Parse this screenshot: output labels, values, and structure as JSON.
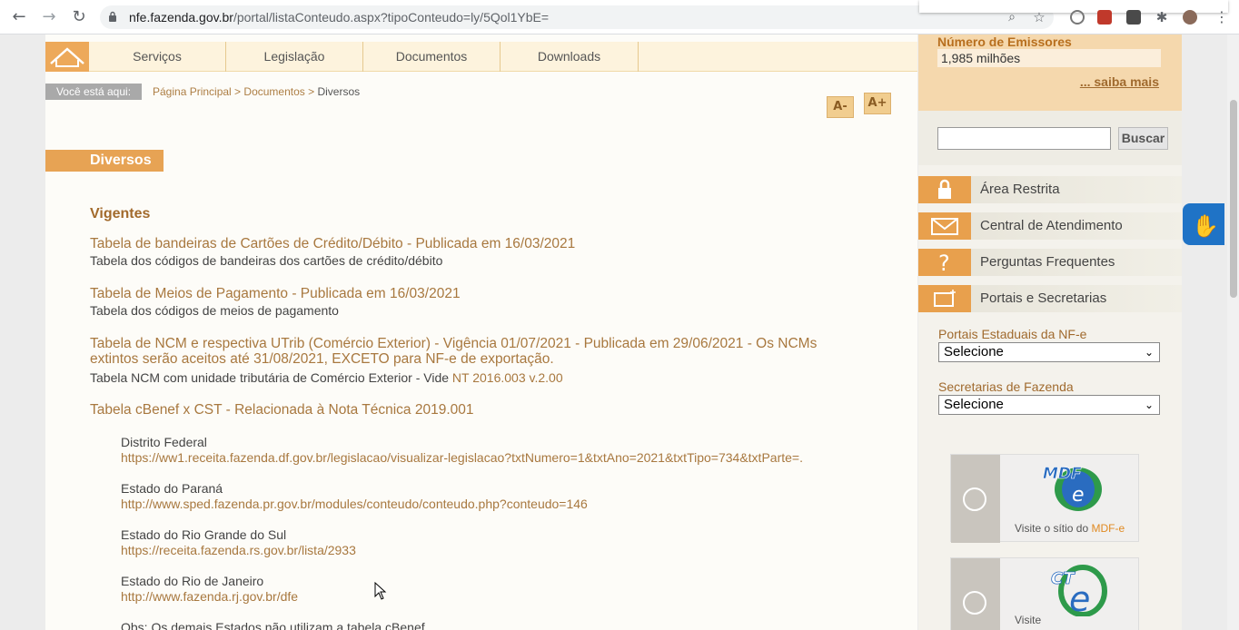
{
  "browser": {
    "url_host": "nfe.fazenda.gov.br",
    "url_path": "/portal/listaConteudo.aspx?tipoConteudo=ly/5Qol1YbE="
  },
  "topnav": {
    "items": [
      "Serviços",
      "Legislação",
      "Documentos",
      "Downloads"
    ]
  },
  "breadcrumb": {
    "label": "Você está aqui:",
    "path": [
      "Página Principal",
      "Documentos"
    ],
    "separator": " > ",
    "current": "Diversos"
  },
  "font_controls": {
    "decrease": "A-",
    "increase": "A+"
  },
  "section": {
    "title": "Diversos",
    "subtitle": "Vigentes"
  },
  "entries": [
    {
      "title": "Tabela de bandeiras de Cartões de Crédito/Débito - Publicada em 16/03/2021",
      "desc": "Tabela dos códigos de bandeiras dos cartões de crédito/débito"
    },
    {
      "title": "Tabela de Meios de Pagamento - Publicada em 16/03/2021",
      "desc": "Tabela dos códigos de meios de pagamento"
    },
    {
      "title": "Tabela de NCM e respectiva UTrib (Comércio Exterior) - Vigência 01/07/2021 - Publicada em 29/06/2021 - Os NCMs extintos serão aceitos até 31/08/2021, EXCETO para NF-e de exportação.",
      "desc": "Tabela NCM com unidade tributária de Comércio Exterior - Vide ",
      "desc_link": "NT 2016.003 v.2.00"
    },
    {
      "title": "Tabela cBenef x CST - Relacionada à Nota Técnica 2019.001"
    }
  ],
  "states": [
    {
      "name": "Distrito Federal",
      "url": "https://ww1.receita.fazenda.df.gov.br/legislacao/visualizar-legislacao?txtNumero=1&txtAno=2021&txtTipo=734&txtParte=."
    },
    {
      "name": "Estado do Paraná",
      "url": "http://www.sped.fazenda.pr.gov.br/modules/conteudo/conteudo.php?conteudo=146"
    },
    {
      "name": "Estado do Rio Grande do Sul",
      "url": "https://receita.fazenda.rs.gov.br/lista/2933"
    },
    {
      "name": "Estado do Rio de Janeiro",
      "url": "http://www.fazenda.rj.gov.br/dfe"
    }
  ],
  "obs": "Obs: Os demais Estados não utilizam a tabela cBenef",
  "sidebar": {
    "emissores_title": "Número de Emissores",
    "emissores_value": "1,985 milhões",
    "saiba_mais": "... saiba mais",
    "search_button": "Buscar",
    "search_value": "",
    "links": [
      "Área Restrita",
      "Central de Atendimento",
      "Perguntas Frequentes",
      "Portais e Secretarias"
    ],
    "portais_label": "Portais Estaduais da NF-e",
    "portais_value": "Selecione",
    "secretarias_label": "Secretarias de Fazenda",
    "secretarias_value": "Selecione",
    "mdfe_text_prefix": "Visite o sítio do ",
    "mdfe_text_brand": "MDF-e",
    "cte_text": "Visite"
  },
  "colors": {
    "accent": "#e7a354",
    "link": "#a8783f",
    "brand_dark": "#a26a2c"
  }
}
